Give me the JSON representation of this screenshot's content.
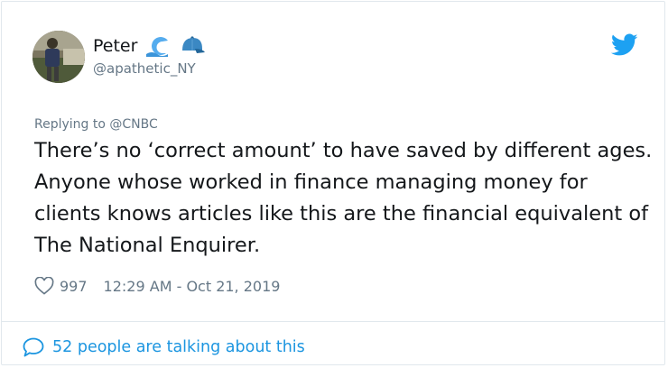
{
  "user": {
    "display_name": "Peter",
    "handle": "@apathetic_NY",
    "emojis": [
      "wave-emoji",
      "blue-cap-emoji"
    ]
  },
  "tweet": {
    "reply_prefix": "Replying to ",
    "reply_mention": "@CNBC",
    "text": "There’s no ‘correct amount’ to have saved by different ages. Anyone whose worked in finance managing money for clients knows articles like this are the financial equivalent of The National Enquirer.",
    "like_count": "997",
    "timestamp": "12:29 AM - Oct 21, 2019"
  },
  "footer": {
    "conversation_label": "52 people are talking about this"
  },
  "colors": {
    "accent": "#1b95e0",
    "text": "#14171a",
    "muted": "#657786",
    "border": "#e1e8ed"
  }
}
